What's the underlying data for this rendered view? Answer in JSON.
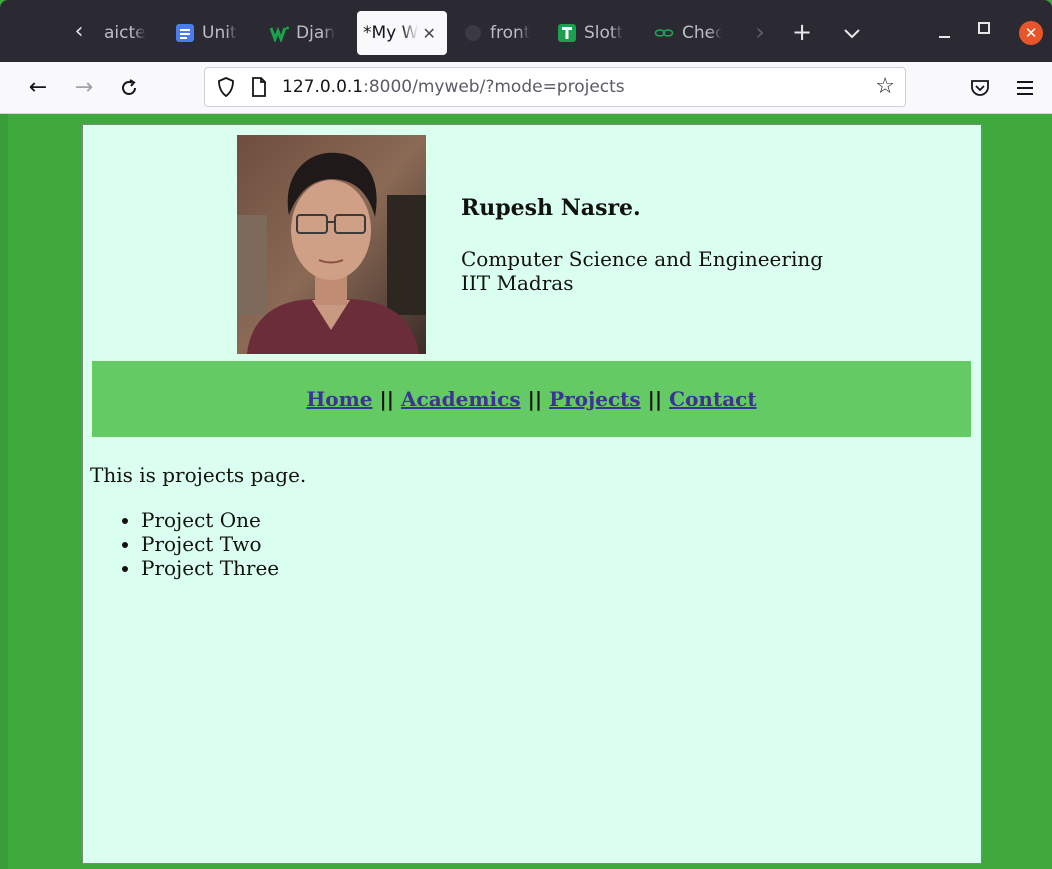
{
  "browser": {
    "tabs": [
      {
        "label": "aicte",
        "active": false
      },
      {
        "label": "Unit",
        "active": false
      },
      {
        "label": "Djan",
        "active": false
      },
      {
        "label": "*My W",
        "active": true
      },
      {
        "label": "front",
        "active": false
      },
      {
        "label": "Slott",
        "active": false
      },
      {
        "label": "Chec",
        "active": false
      }
    ],
    "new_tab_glyph": "+",
    "tab_list_glyph": "⌄",
    "url_host": "127.0.0.1",
    "url_rest": ":8000/myweb/?mode=projects",
    "colors": {
      "tabbar": "#2b2a33",
      "toolbar": "#f9f9fb",
      "close_button": "#e9552a"
    }
  },
  "page": {
    "name": "Rupesh Nasre.",
    "department": "Computer Science and Engineering",
    "institute": "IIT Madras",
    "nav": {
      "home": "Home",
      "academics": "Academics",
      "projects": "Projects",
      "contact": "Contact",
      "separator": "||"
    },
    "intro": "This is projects page.",
    "projects": [
      "Project One",
      "Project Two",
      "Project Three"
    ],
    "colors": {
      "page_background": "#3fa93d",
      "panel_background": "#dbffee",
      "nav_band": "#64cb64",
      "link": "#3a3594"
    }
  }
}
